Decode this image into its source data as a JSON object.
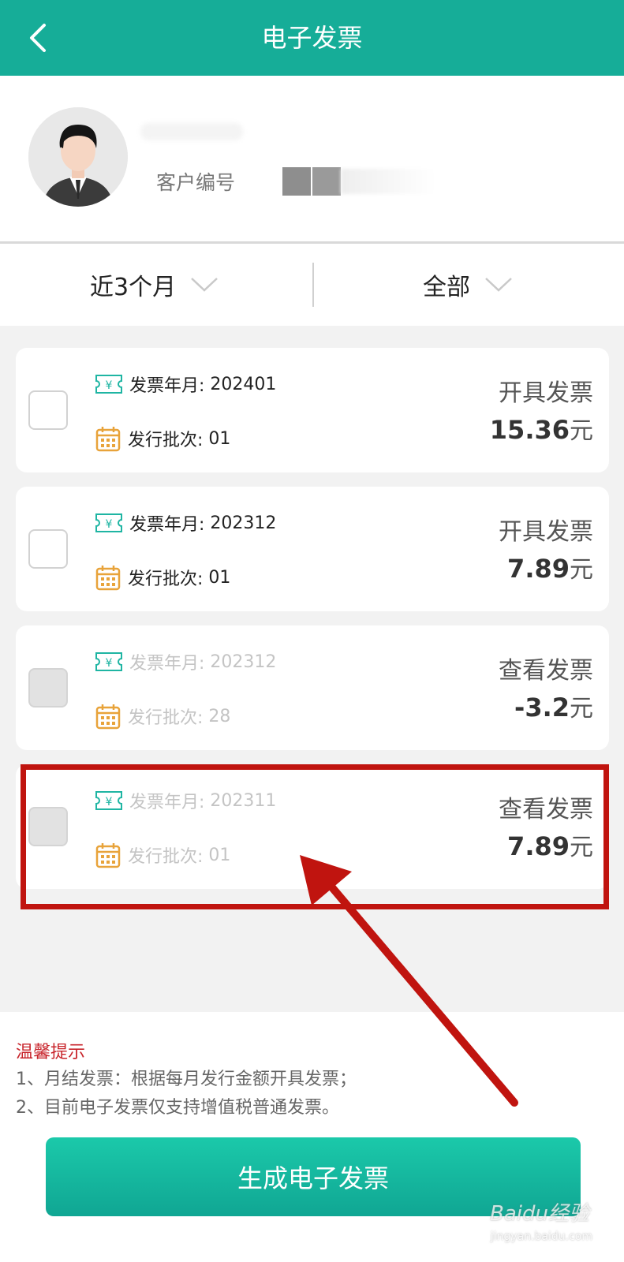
{
  "header": {
    "title": "电子发票"
  },
  "profile": {
    "customer_label": "客户编号"
  },
  "filters": {
    "period": "近3个月",
    "status": "全部"
  },
  "invoices": [
    {
      "ym_label": "发票年月:",
      "ym_value": "202401",
      "batch_label": "发行批次:",
      "batch_value": "01",
      "action": "开具发票",
      "amount": "15.36",
      "unit": "元",
      "enabled": true
    },
    {
      "ym_label": "发票年月:",
      "ym_value": "202312",
      "batch_label": "发行批次:",
      "batch_value": "01",
      "action": "开具发票",
      "amount": "7.89",
      "unit": "元",
      "enabled": true
    },
    {
      "ym_label": "发票年月:",
      "ym_value": "202312",
      "batch_label": "发行批次:",
      "batch_value": "28",
      "action": "查看发票",
      "amount": "-3.2",
      "unit": "元",
      "enabled": false
    },
    {
      "ym_label": "发票年月:",
      "ym_value": "202311",
      "batch_label": "发行批次:",
      "batch_value": "01",
      "action": "查看发票",
      "amount": "7.89",
      "unit": "元",
      "enabled": false
    }
  ],
  "tips": {
    "title": "温馨提示",
    "lines": [
      "1、月结发票：根据每月发行金额开具发票；",
      "2、目前电子发票仅支持增值税普通发票。"
    ]
  },
  "generate_button": "生成电子发票",
  "watermark": {
    "main": "Baidu经验",
    "sub": "jingyan.baidu.com"
  },
  "colors": {
    "brand": "#16ad98",
    "highlight": "#c0140f",
    "tip_title": "#c8242b",
    "ticket_icon": "#1fb5a3",
    "calendar_icon": "#e8a33a"
  },
  "icons": {
    "back": "chevron-left-icon",
    "dropdown": "chevron-down-icon",
    "invoice": "ticket-yuan-icon",
    "batch": "calendar-icon"
  }
}
